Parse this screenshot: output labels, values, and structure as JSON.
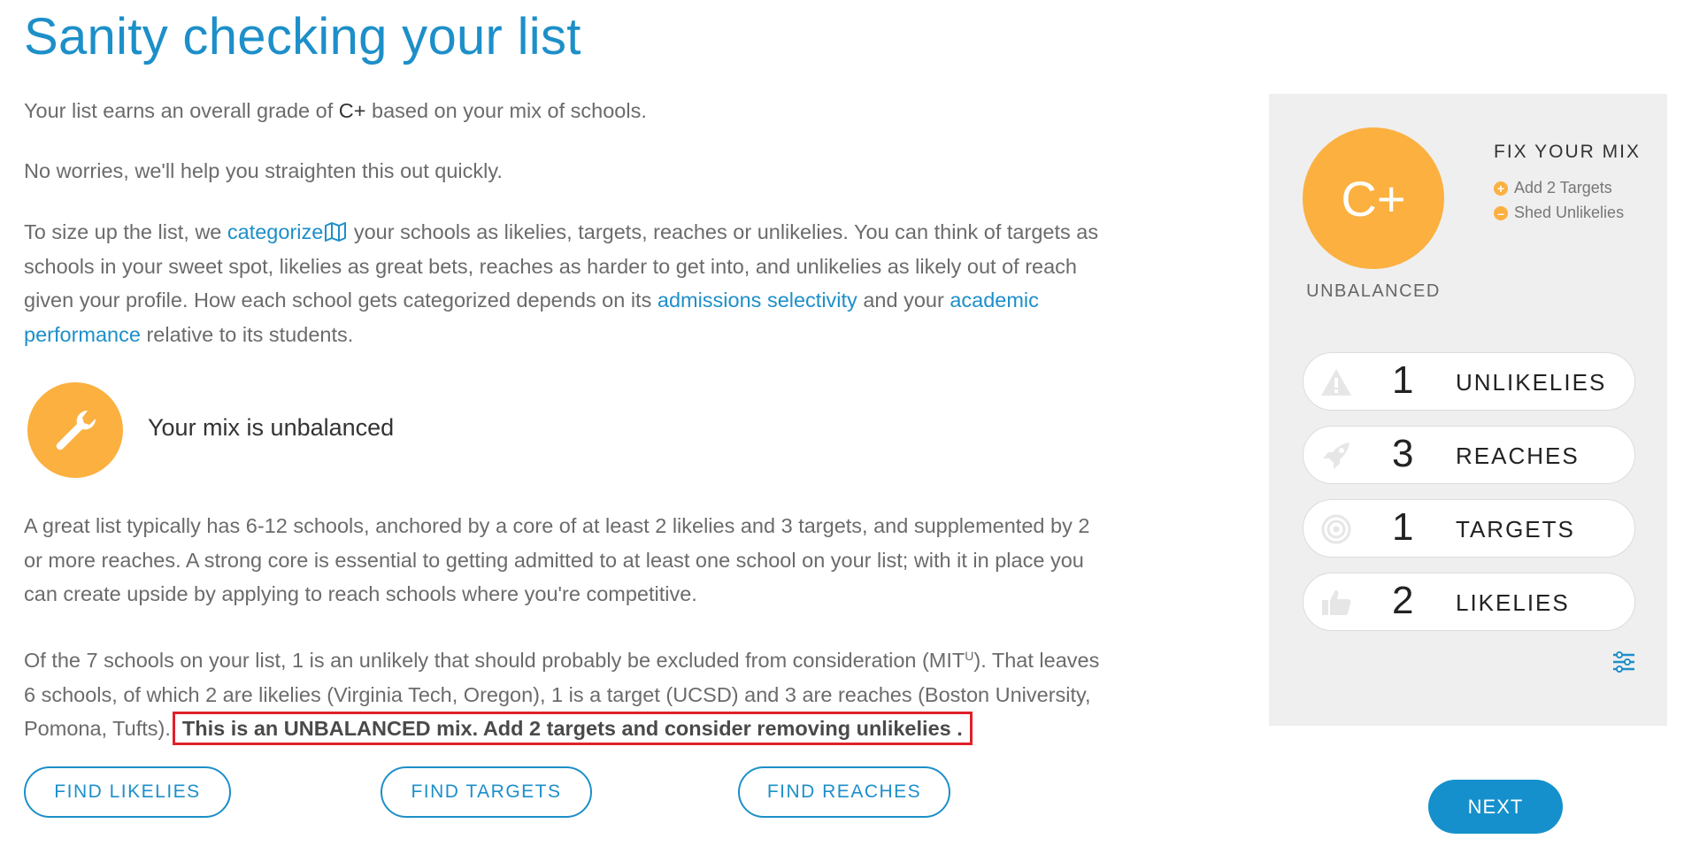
{
  "title": "Sanity checking your list",
  "intro": {
    "grade_prefix": "Your list earns an overall grade of ",
    "grade": "C+",
    "grade_suffix": " based on your mix of schools.",
    "reassure": "No worries, we'll help you straighten this out quickly."
  },
  "explain": {
    "p1": "To size up the list, we ",
    "link_categorize": "categorize",
    "p2": " your schools as likelies, targets, reaches or unlikelies. You can think of targets as schools in your sweet spot, likelies as great bets, reaches as harder to get into, and unlikelies as likely out of reach given your profile. How each school gets categorized depends on its ",
    "link_selectivity": "admissions selectivity",
    "p3": " and your ",
    "link_academic": "academic performance",
    "p4": " relative to its students."
  },
  "mix": {
    "icon": "wrench-icon",
    "label": "Your mix is unbalanced"
  },
  "great_list": "A great list typically has 6-12 schools, anchored by a core of at least 2 likelies and 3 targets, and supplemented by 2 or more reaches. A strong core is essential to getting admitted to at least one school on your list; with it in place you can create upside by applying to reach schools where you're competitive.",
  "summary": {
    "text1": "Of the 7 schools on your list, 1 is an unlikely that should probably be excluded from consideration (MIT",
    "sup": "U",
    "text2": "). That leaves 6 schools, of which 2 are likelies (Virginia Tech, Oregon), 1 is a target (UCSD) and 3 are reaches (Boston University, Pomona, Tufts).",
    "highlight": "This is an UNBALANCED mix. Add 2 targets and consider removing unlikelies ."
  },
  "buttons": {
    "find_likelies": "FIND LIKELIES",
    "find_targets": "FIND TARGETS",
    "find_reaches": "FIND REACHES",
    "next": "NEXT"
  },
  "panel": {
    "grade": "C+",
    "status": "UNBALANCED",
    "fix_title": "FIX YOUR MIX",
    "fix_add": "Add 2 Targets",
    "fix_shed": "Shed Unlikelies",
    "categories": [
      {
        "icon": "warning-icon",
        "count": "1",
        "label": "UNLIKELIES"
      },
      {
        "icon": "rocket-icon",
        "count": "3",
        "label": "REACHES"
      },
      {
        "icon": "target-icon",
        "count": "1",
        "label": "TARGETS"
      },
      {
        "icon": "thumbs-up-icon",
        "count": "2",
        "label": "LIKELIES"
      }
    ],
    "filter_icon": "sliders-icon"
  },
  "colors": {
    "accent_blue": "#1d8fc9",
    "grade_orange": "#fbb040",
    "highlight_border": "#e0202a",
    "panel_bg": "#efefef"
  }
}
